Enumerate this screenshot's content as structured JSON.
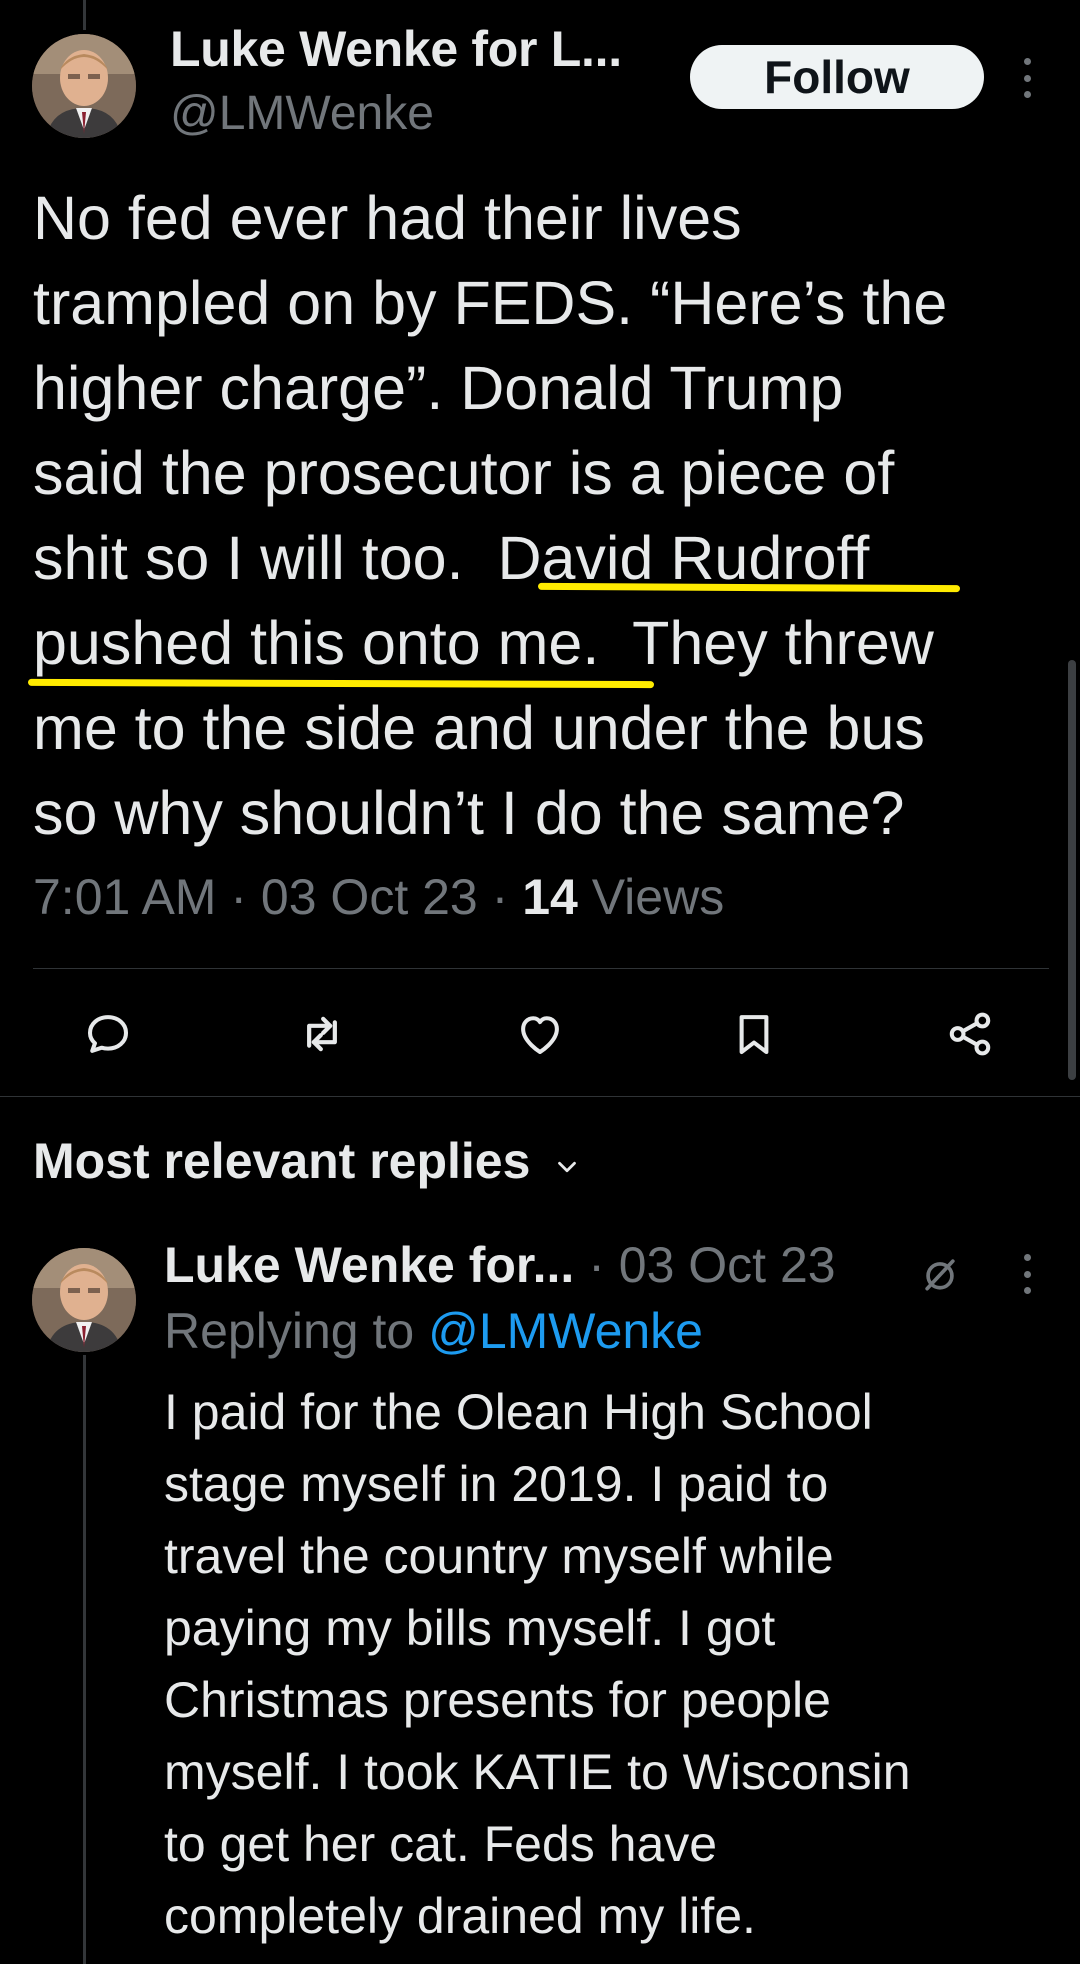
{
  "tweet": {
    "author_name": "Luke Wenke for L...",
    "handle": "@LMWenke",
    "follow_label": "Follow",
    "text_lines": [
      "No fed ever had their lives",
      "trampled on by FEDS.  “Here’s the",
      "higher charge”.  Donald Trump",
      "said the prosecutor is a piece of",
      "shit so I will too.  ",
      "David Rudroff",
      "pushed this onto me.",
      "  They threw",
      "me to the side and under the bus",
      "so why shouldn’t I do the same?"
    ],
    "time": "7:01 AM",
    "separator": "·",
    "date": "03 Oct 23",
    "views_count": "14",
    "views_label": "Views",
    "highlight_color": "#ffeb00"
  },
  "actions": [
    {
      "name": "reply",
      "icon": "reply-icon"
    },
    {
      "name": "retweet",
      "icon": "retweet-icon"
    },
    {
      "name": "like",
      "icon": "heart-icon"
    },
    {
      "name": "bookmark",
      "icon": "bookmark-icon"
    },
    {
      "name": "share",
      "icon": "share-icon"
    }
  ],
  "replies": {
    "header": "Most relevant replies",
    "items": [
      {
        "author_name": "Luke Wenke for...",
        "separator": "·",
        "date": "03 Oct 23",
        "replying_prefix": "Replying to",
        "replying_to": "@LMWenke",
        "text_lines": [
          "I paid for the Olean High School",
          "stage myself in 2019.  I paid to",
          "travel the country myself while",
          "paying my bills myself.  I got",
          "Christmas presents for people",
          "myself.  I took KATIE to Wisconsin",
          "to get her cat.  Feds have",
          "completely drained my life."
        ]
      }
    ]
  },
  "colors": {
    "background": "#000000",
    "text": "#e7e9ea",
    "muted": "#71767b",
    "link": "#1d9bf0",
    "divider": "#2f3336"
  }
}
